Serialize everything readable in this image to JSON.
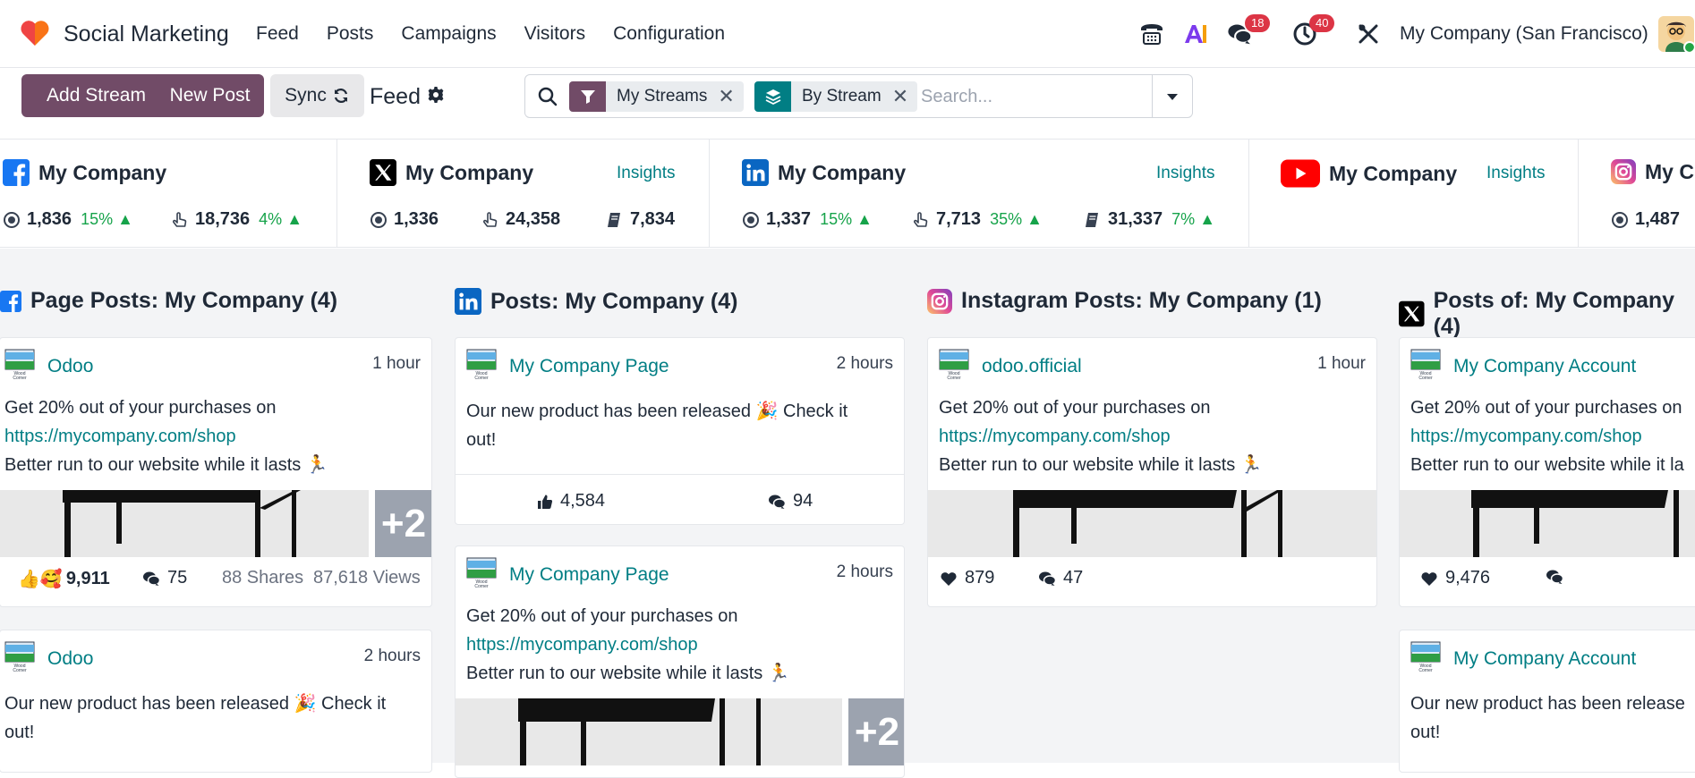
{
  "app": {
    "name": "Social Marketing"
  },
  "menu": [
    "Feed",
    "Posts",
    "Campaigns",
    "Visitors",
    "Configuration"
  ],
  "systray": {
    "messages_count": "18",
    "activities_count": "40",
    "company": "My Company (San Francisco)"
  },
  "toolbar": {
    "add_stream": "Add Stream",
    "new_post": "New Post",
    "sync": "Sync",
    "view_title": "Feed"
  },
  "search": {
    "facets": [
      {
        "label": "My Streams"
      },
      {
        "label": "By Stream"
      }
    ],
    "placeholder": "Search..."
  },
  "accounts": [
    {
      "network": "facebook",
      "name": "My Company",
      "stats": [
        {
          "icon": "audience-icon",
          "value": "1,836",
          "trend": "15%"
        },
        {
          "icon": "engagement-icon",
          "value": "18,736",
          "trend": "4%"
        }
      ]
    },
    {
      "network": "x",
      "name": "My Company",
      "insights": "Insights",
      "stats": [
        {
          "icon": "audience-icon",
          "value": "1,336"
        },
        {
          "icon": "engagement-icon",
          "value": "24,358"
        },
        {
          "icon": "stories-icon",
          "value": "7,834"
        }
      ]
    },
    {
      "network": "linkedin",
      "name": "My Company",
      "insights": "Insights",
      "stats": [
        {
          "icon": "audience-icon",
          "value": "1,337",
          "trend": "15%"
        },
        {
          "icon": "engagement-icon",
          "value": "7,713",
          "trend": "35%"
        },
        {
          "icon": "stories-icon",
          "value": "31,337",
          "trend": "7%"
        }
      ]
    },
    {
      "network": "youtube",
      "name": "My Company",
      "insights": "Insights",
      "stats": []
    },
    {
      "network": "instagram",
      "name": "My C",
      "stats": [
        {
          "icon": "audience-icon",
          "value": "1,487"
        }
      ]
    }
  ],
  "streams": [
    {
      "network": "facebook",
      "title": "Page Posts: My Company (4)",
      "posts": [
        {
          "author": "Odoo",
          "time": "1 hour",
          "text1": "Get 20% out of your purchases on",
          "link": "https://mycompany.com/shop",
          "text2": "Better run to our website while it lasts 🏃",
          "extra_images": "+2",
          "likes": "9,911",
          "comments": "75",
          "shares": "88 Shares",
          "views": "87,618 Views"
        },
        {
          "author": "Odoo",
          "time": "2 hours",
          "text1": "Our new product has been released 🎉 Check it",
          "text2": "out!"
        }
      ]
    },
    {
      "network": "linkedin",
      "title": "Posts: My Company (4)",
      "posts": [
        {
          "author": "My Company Page",
          "time": "2 hours",
          "text1": "Our new product has been released 🎉 Check it",
          "text2": "out!",
          "likes": "4,584",
          "comments": "94"
        },
        {
          "author": "My Company Page",
          "time": "2 hours",
          "text1": "Get 20% out of your purchases on",
          "link": "https://mycompany.com/shop",
          "text2": "Better run to our website while it lasts 🏃",
          "extra_images": "+2"
        }
      ]
    },
    {
      "network": "instagram",
      "title": "Instagram Posts: My Company (1)",
      "posts": [
        {
          "author": "odoo.official",
          "time": "1 hour",
          "text1": "Get 20% out of your purchases on",
          "link": "https://mycompany.com/shop",
          "text2": "Better run to our website while it lasts 🏃",
          "likes": "879",
          "comments": "47"
        }
      ]
    },
    {
      "network": "x",
      "title": "Posts of: My Company (4)",
      "posts": [
        {
          "author": "My Company Account",
          "text1": "Get 20% out of your purchases on",
          "link": "https://mycompany.com/shop",
          "text2": "Better run to our website while it la",
          "likes": "9,476"
        },
        {
          "author": "My Company Account",
          "text1": "Our new product has been release",
          "text2": "out!"
        }
      ]
    }
  ],
  "colors": {
    "brand": "#714b67",
    "accent": "#017e84",
    "facet_filter": "#714b67",
    "facet_group": "#017e84",
    "facebook": "#1877f2",
    "linkedin": "#0a66c2",
    "youtube": "#ff0000",
    "trend_up": "#16a34a",
    "badge": "#dc3545"
  }
}
